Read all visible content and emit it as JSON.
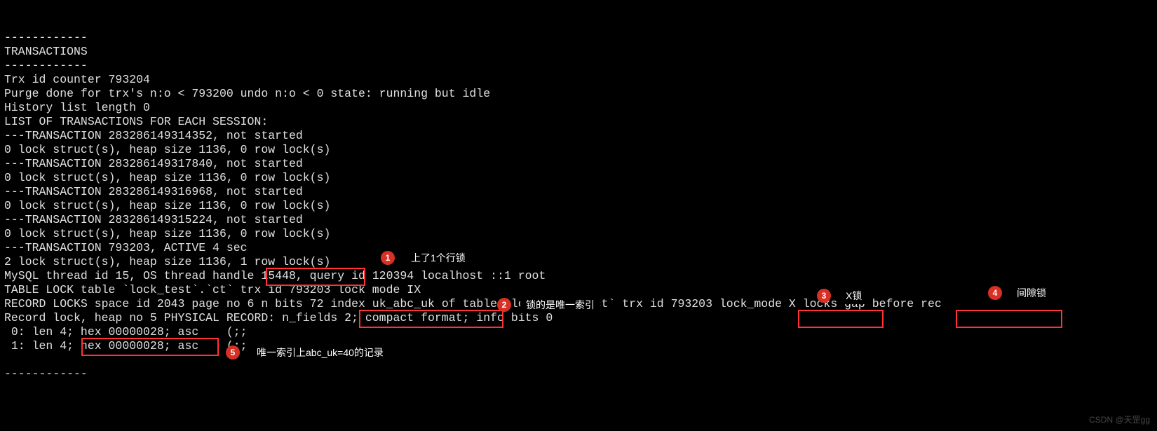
{
  "terminal": {
    "dash_top": "------------",
    "hdr": "TRANSACTIONS",
    "dash_mid": "------------",
    "l_trxid": "Trx id counter 793204",
    "l_purge": "Purge done for trx's n:o < 793200 undo n:o < 0 state: running but idle",
    "l_hist": "History list length 0",
    "l_listhdr": "LIST OF TRANSACTIONS FOR EACH SESSION:",
    "l_t1": "---TRANSACTION 283286149314352, not started",
    "l_t1a": "0 lock struct(s), heap size 1136, 0 row lock(s)",
    "l_t2": "---TRANSACTION 283286149317840, not started",
    "l_t2a": "0 lock struct(s), heap size 1136, 0 row lock(s)",
    "l_t3": "---TRANSACTION 283286149316968, not started",
    "l_t3a": "0 lock struct(s), heap size 1136, 0 row lock(s)",
    "l_t4": "---TRANSACTION 283286149315224, not started",
    "l_t4a": "0 lock struct(s), heap size 1136, 0 row lock(s)",
    "l_t5": "---TRANSACTION 793203, ACTIVE 4 sec",
    "l_t5a_pre": "2 lock struct(s), heap size 1136, ",
    "l_t5a_box": "1 row lock(s)",
    "l_thread": "MySQL thread id 15, OS thread handle 15448, query id 120394 localhost ::1 root",
    "l_tablelock": "TABLE LOCK table `lock_test`.`ct` trx id 793203 lock mode IX",
    "l_rec_pre": "RECORD LOCKS space id 2043 page no 6 n bits 72 ",
    "l_rec_idx": "index uk_abc_uk",
    "l_rec_mid": " of table `lock_test`.`ct` trx id 793203 ",
    "l_rec_mode": "lock_mode X",
    "l_rec_mid2": " locks ",
    "l_rec_gap": "gap before rec",
    "l_phys": "Record lock, heap no 5 PHYSICAL RECORD: n_fields 2; compact format; info bits 0",
    "l_rec0_pre": " 0: len 4; ",
    "l_rec0_hex": "hex 00000028;",
    "l_rec0_post": " asc    (;;",
    "l_rec1": " 1: len 4; hex 00000028; asc    (;;",
    "dash_bot": "------------"
  },
  "annotations": {
    "a1": {
      "num": "1",
      "text": "上了1个行锁"
    },
    "a2": {
      "num": "2",
      "text": "锁的是唯一索引"
    },
    "a3": {
      "num": "3",
      "text": "X锁"
    },
    "a4": {
      "num": "4",
      "text": "间隙锁"
    },
    "a5": {
      "num": "5",
      "text": "唯一索引上abc_uk=40的记录"
    }
  },
  "watermark": "CSDN @天罡gg"
}
